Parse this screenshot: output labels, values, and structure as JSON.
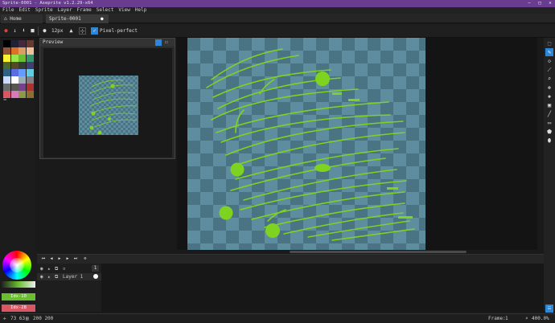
{
  "window": {
    "title": "Sprite-0001 - Aseprite v1.2.29-x64",
    "controls": [
      "–",
      "□",
      "✕"
    ]
  },
  "menu": [
    "File",
    "Edit",
    "Sprite",
    "Layer",
    "Frame",
    "Select",
    "View",
    "Help"
  ],
  "tabs": [
    {
      "label": "Home"
    },
    {
      "label": "Sprite-0001"
    }
  ],
  "toolbar": {
    "brush_size": "12px",
    "pixel_perfect": "Pixel-perfect"
  },
  "preview": {
    "title": "Preview"
  },
  "palette": {
    "colors": [
      "#000000",
      "#222034",
      "#45283c",
      "#663931",
      "#8f563b",
      "#df7126",
      "#d9a066",
      "#eec39a",
      "#fbf236",
      "#99e550",
      "#6abe30",
      "#37946e",
      "#4b692f",
      "#524b24",
      "#323c39",
      "#3f3f74",
      "#306082",
      "#5b6ee1",
      "#639bff",
      "#5fcde4",
      "#cbdbfc",
      "#ffffff",
      "#9badb7",
      "#847e87",
      "#696a6a",
      "#595652",
      "#76428a",
      "#ac3232",
      "#d95763",
      "#d77bba",
      "#8f974a",
      "#8a6f30"
    ]
  },
  "colors": {
    "foreground": "#6abe30",
    "background": "#d95763",
    "fg_label": "Idx-10",
    "bg_label": "Idx-28",
    "accent": "#2e86d6",
    "checker_a": "#5e8da0",
    "checker_b": "#4a7384",
    "stroke": "#7ed321"
  },
  "timeline": {
    "frame_number": "1",
    "layer_name": "Layer 1"
  },
  "status": {
    "cursor": "73 63",
    "size": "200 200",
    "frame_label": "Frame:",
    "frame_value": "1",
    "zoom": "400.0%"
  }
}
